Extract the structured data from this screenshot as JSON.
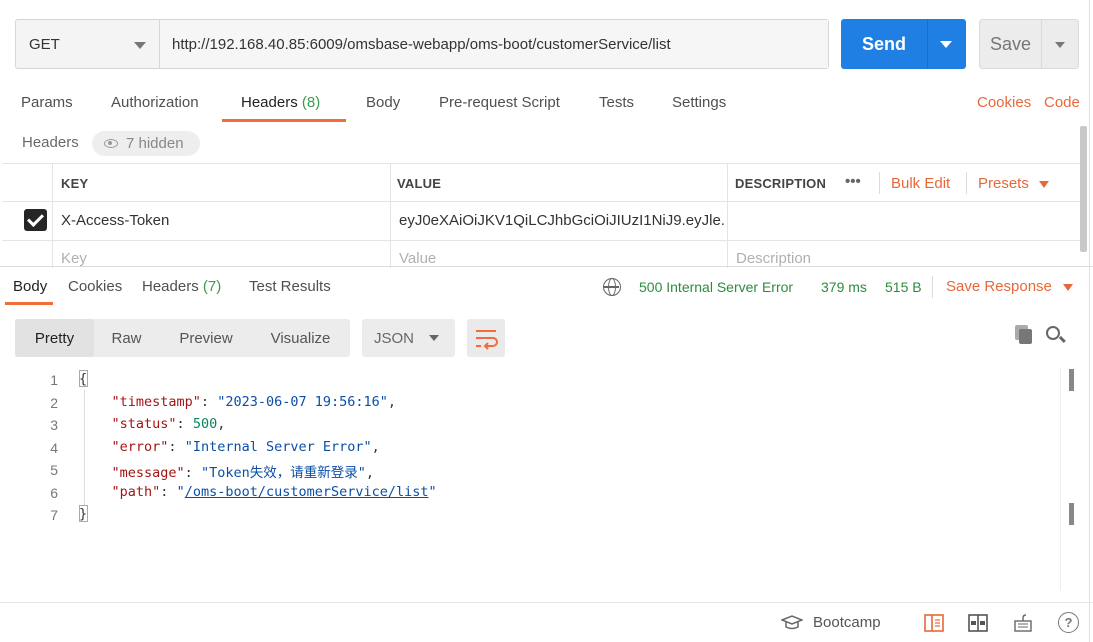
{
  "request": {
    "method": "GET",
    "url": "http://192.168.40.85:6009/omsbase-webapp/oms-boot/customerService/list",
    "send_label": "Send",
    "save_label": "Save"
  },
  "request_tabs": [
    {
      "label": "Params",
      "count": ""
    },
    {
      "label": "Authorization",
      "count": ""
    },
    {
      "label": "Headers",
      "count": "(8)"
    },
    {
      "label": "Body",
      "count": ""
    },
    {
      "label": "Pre-request Script",
      "count": ""
    },
    {
      "label": "Tests",
      "count": ""
    },
    {
      "label": "Settings",
      "count": ""
    }
  ],
  "right_links": {
    "cookies": "Cookies",
    "code": "Code"
  },
  "headers_section": {
    "title": "Headers",
    "hidden_label": "7 hidden",
    "columns": {
      "key": "KEY",
      "value": "VALUE",
      "description": "DESCRIPTION"
    },
    "more_label": "•••",
    "bulk_edit": "Bulk Edit",
    "presets": "Presets",
    "rows": [
      {
        "checked": true,
        "key": "X-Access-Token",
        "value": "eyJ0eXAiOiJKV1QiLCJhbGciOiJIUzI1NiJ9.eyJle...",
        "description": ""
      }
    ],
    "placeholders": {
      "key": "Key",
      "value": "Value",
      "description": "Description"
    }
  },
  "response_tabs": [
    {
      "label": "Body",
      "count": ""
    },
    {
      "label": "Cookies",
      "count": ""
    },
    {
      "label": "Headers",
      "count": "(7)"
    },
    {
      "label": "Test Results",
      "count": ""
    }
  ],
  "response_meta": {
    "status": "500 Internal Server Error",
    "time": "379 ms",
    "size": "515 B",
    "save_response": "Save Response"
  },
  "view_modes": [
    "Pretty",
    "Raw",
    "Preview",
    "Visualize"
  ],
  "active_view": "Pretty",
  "format": "JSON",
  "code_lines": [
    {
      "n": "1",
      "text": "{"
    },
    {
      "n": "2",
      "key": "\"timestamp\"",
      "value": "\"2023-06-07 19:56:16\"",
      "type": "str"
    },
    {
      "n": "3",
      "key": "\"status\"",
      "value": "500",
      "type": "num"
    },
    {
      "n": "4",
      "key": "\"error\"",
      "value": "\"Internal Server Error\"",
      "type": "str"
    },
    {
      "n": "5",
      "key": "\"message\"",
      "value": "\"Token失效，请重新登录\"",
      "type": "str"
    },
    {
      "n": "6",
      "key": "\"path\"",
      "value_prefix": "\"",
      "value_link": "/oms-boot/customerService/list",
      "value_suffix": "\"",
      "type": "link"
    },
    {
      "n": "7",
      "text": "}"
    }
  ],
  "footer": {
    "bootcamp": "Bootcamp",
    "help": "?"
  },
  "colors": {
    "accent": "#f26b3a",
    "send_blue": "#1f7fe3",
    "status_green": "#2e8b40"
  }
}
